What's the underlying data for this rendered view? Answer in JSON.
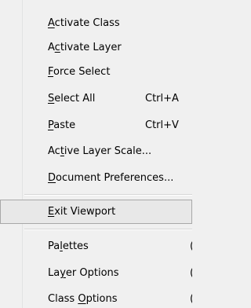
{
  "menu": {
    "items": [
      {
        "pre": "",
        "mnemonic": "A",
        "post": "ctivate Class",
        "shortcut": "",
        "hint": ""
      },
      {
        "pre": "A",
        "mnemonic": "c",
        "post": "tivate Layer",
        "shortcut": "",
        "hint": ""
      },
      {
        "pre": "",
        "mnemonic": "F",
        "post": "orce Select",
        "shortcut": "",
        "hint": ""
      },
      {
        "pre": "",
        "mnemonic": "S",
        "post": "elect All",
        "shortcut": "Ctrl+A",
        "hint": ""
      },
      {
        "pre": "",
        "mnemonic": "P",
        "post": "aste",
        "shortcut": "Ctrl+V",
        "hint": ""
      },
      {
        "pre": "Ac",
        "mnemonic": "t",
        "post": "ive Layer Scale...",
        "shortcut": "",
        "hint": ""
      },
      {
        "pre": "",
        "mnemonic": "D",
        "post": "ocument Preferences...",
        "shortcut": "",
        "hint": ""
      },
      {
        "pre": "",
        "mnemonic": "E",
        "post": "xit Viewport",
        "shortcut": "",
        "hint": ""
      },
      {
        "pre": "Pa",
        "mnemonic": "l",
        "post": "ettes",
        "shortcut": "",
        "hint": "("
      },
      {
        "pre": "La",
        "mnemonic": "y",
        "post": "er Options",
        "shortcut": "",
        "hint": "("
      },
      {
        "pre": "Class ",
        "mnemonic": "O",
        "post": "ptions",
        "shortcut": "",
        "hint": "("
      }
    ]
  }
}
